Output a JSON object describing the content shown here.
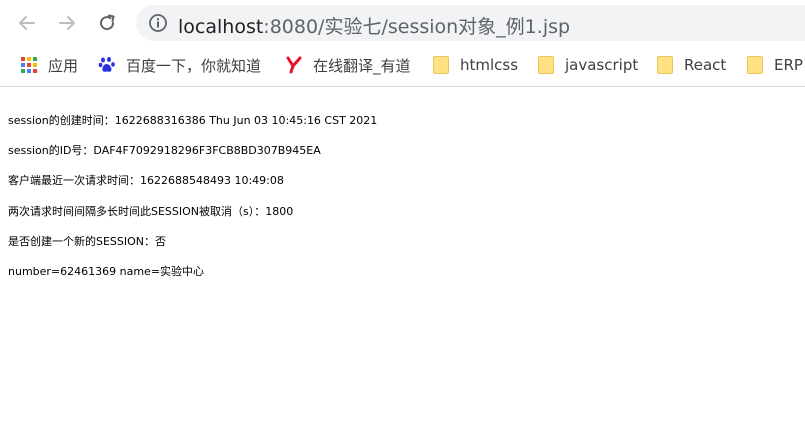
{
  "toolbar": {
    "url_host": "localhost",
    "url_rest": ":8080/实验七/session对象_例1.jsp"
  },
  "bookmarks": [
    {
      "label": "应用",
      "icon": "apps-grid-icon"
    },
    {
      "label": "百度一下，你就知道",
      "icon": "baidu-paw-icon"
    },
    {
      "label": "在线翻译_有道",
      "icon": "youdao-y-icon"
    },
    {
      "label": "htmlcss",
      "icon": "folder-icon"
    },
    {
      "label": "javascript",
      "icon": "folder-icon"
    },
    {
      "label": "React",
      "icon": "folder-icon"
    },
    {
      "label": "ERP",
      "icon": "folder-icon"
    }
  ],
  "page": {
    "lines": [
      "session的创建时间：1622688316386  Thu Jun 03 10:45:16 CST 2021",
      "session的ID号：DAF4F7092918296F3FCB8BD307B945EA",
      "客户端最近一次请求时间：1622688548493  10:49:08",
      "两次请求时间间隔多长时间此SESSION被取消（s）：1800",
      "是否创建一个新的SESSION：否",
      "number=62461369 name=实验中心"
    ]
  },
  "colors": {
    "omnibox_bg": "#f1f3f4",
    "youdao_red": "#e8112d",
    "baidu_blue": "#2932e1",
    "folder_yellow": "#ffe082"
  }
}
